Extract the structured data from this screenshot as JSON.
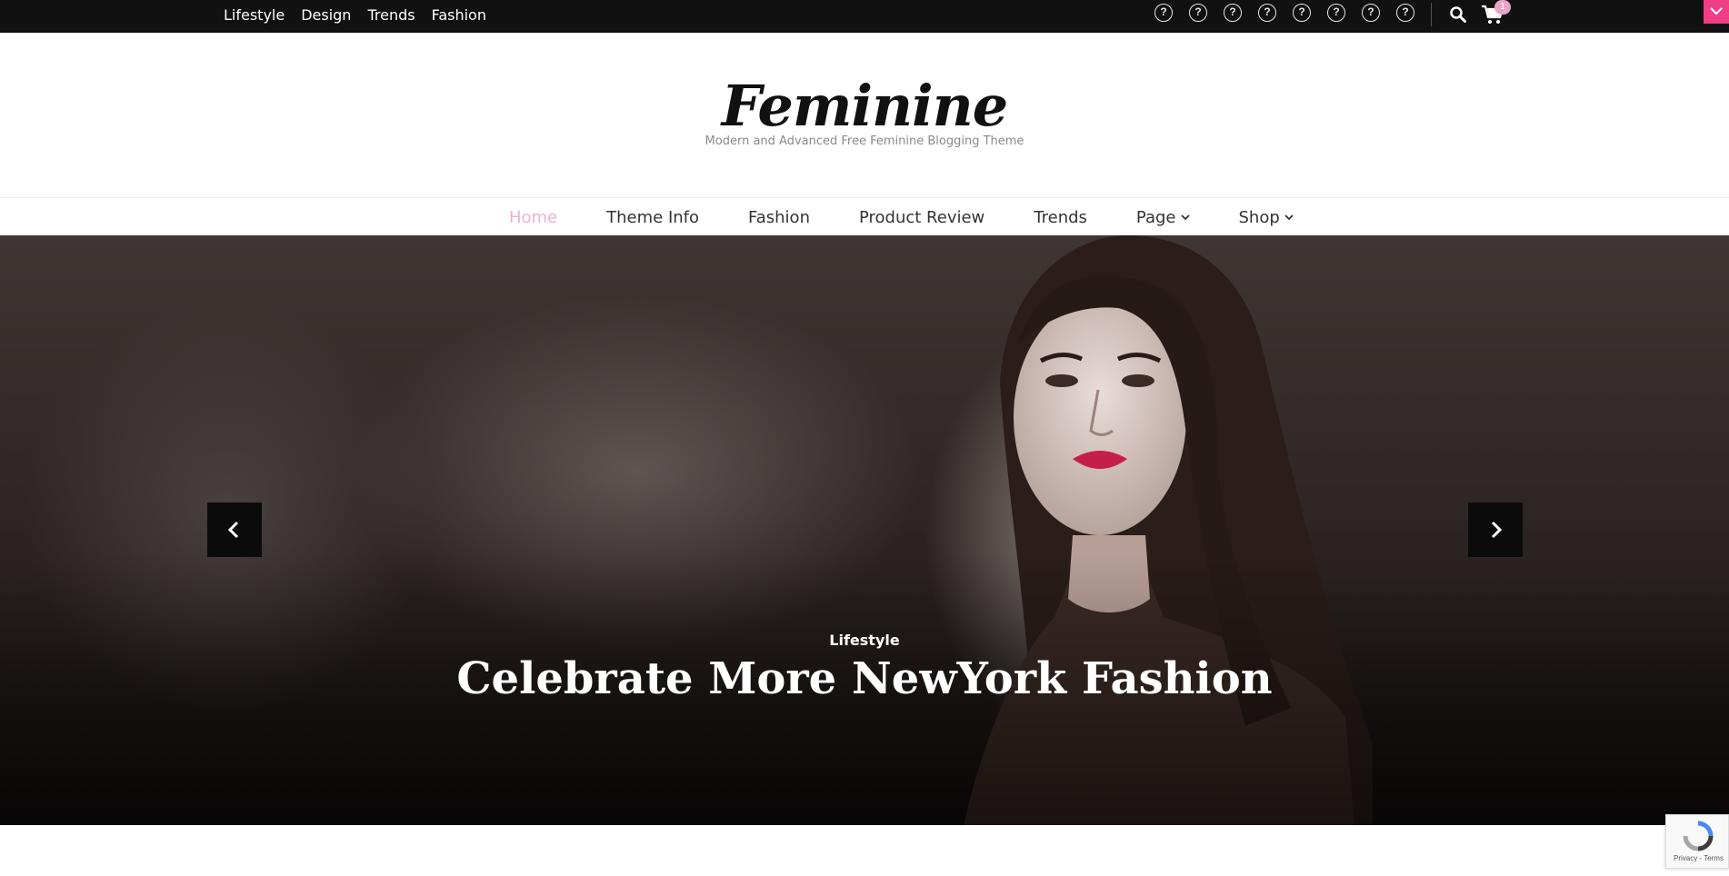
{
  "topbar": {
    "links": [
      "Lifestyle",
      "Design",
      "Trends",
      "Fashion"
    ],
    "social_icons": [
      "unknown-icon",
      "unknown-icon",
      "unknown-icon",
      "unknown-icon",
      "unknown-icon",
      "unknown-icon",
      "unknown-icon",
      "unknown-icon"
    ],
    "social_glyph": "?",
    "cart_count": "1"
  },
  "branding": {
    "title": "Feminine",
    "tagline": "Modern and Advanced Free Feminine Blogging Theme"
  },
  "nav": {
    "items": [
      "Home",
      "Theme Info",
      "Fashion",
      "Product Review",
      "Trends",
      "Page",
      "Shop"
    ],
    "active": "Home"
  },
  "hero": {
    "category": "Lifestyle",
    "title": "Celebrate More NewYork Fashion"
  },
  "recaptcha": {
    "links": "Privacy - Terms"
  },
  "colors": {
    "topbar_bg": "#111111",
    "accent_pink": "#ef3e86",
    "nav_active": "#ecb2cf"
  }
}
